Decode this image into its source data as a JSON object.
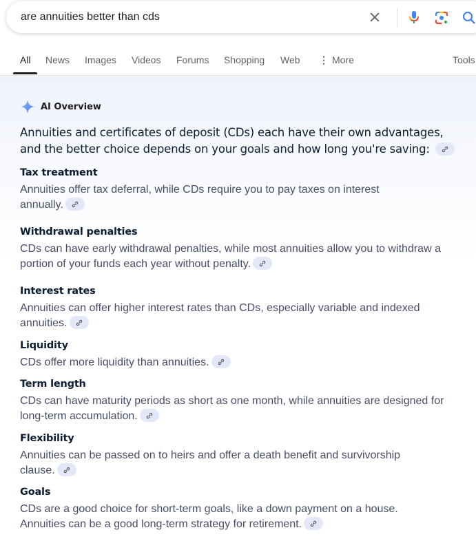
{
  "search": {
    "query": "are annuities better than cds",
    "clear_icon": "close-icon",
    "voice_icon": "microphone-icon",
    "lens_icon": "google-lens-icon",
    "search_icon": "search-icon"
  },
  "tabs": {
    "items": [
      {
        "label": "All",
        "active": true
      },
      {
        "label": "News"
      },
      {
        "label": "Images"
      },
      {
        "label": "Videos"
      },
      {
        "label": "Forums"
      },
      {
        "label": "Shopping"
      },
      {
        "label": "Web"
      },
      {
        "label": "More",
        "icon": "more-vert-icon"
      }
    ],
    "tools_label": "Tools"
  },
  "ai_overview": {
    "title": "AI Overview",
    "icon": "sparkle-icon",
    "intro": "Annuities and certificates of deposit (CDs) each have their own advantages, and the better choice depends on your goals and how long you're saving:",
    "sections": [
      {
        "title": "Tax treatment",
        "body": "Annuities offer tax deferral, while CDs require you to pay taxes on interest annually."
      },
      {
        "title": "Withdrawal penalties",
        "body": "CDs can have early withdrawal penalties, while most annuities allow you to withdraw a portion of your funds each year without penalty."
      },
      {
        "title": "Interest rates",
        "body": "Annuities can offer higher interest rates than CDs, especially variable and indexed annuities."
      },
      {
        "title": "Liquidity",
        "body": "CDs offer more liquidity than annuities."
      },
      {
        "title": "Term length",
        "body": "CDs can have maturity periods as short as one month, while annuities are designed for long-term accumulation."
      },
      {
        "title": "Flexibility",
        "body": "Annuities can be passed on to heirs and offer a death benefit and survivorship clause."
      },
      {
        "title": "Goals",
        "body": "CDs are a good choice for short-term goals, like a down payment on a house. Annuities can be a good long-term strategy for retirement."
      }
    ]
  },
  "colors": {
    "accent_blue": "#4285f4",
    "chip_bg": "#e3e8f8",
    "heading": "#0b1e33",
    "body_text": "#474d66"
  }
}
